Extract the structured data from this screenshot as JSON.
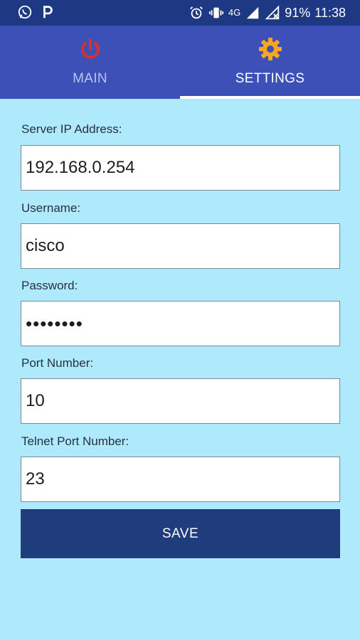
{
  "status_bar": {
    "left_icons": [
      "whatsapp-icon",
      "p-app-icon"
    ],
    "network": "4G",
    "battery": "91%",
    "time": "11:38"
  },
  "tabs": [
    {
      "label": "MAIN",
      "icon": "power-icon",
      "selected": false
    },
    {
      "label": "SETTINGS",
      "icon": "gear-icon",
      "selected": true
    }
  ],
  "form": {
    "server_ip": {
      "label": "Server IP Address:",
      "value": "192.168.0.254"
    },
    "username": {
      "label": "Username:",
      "value": "cisco"
    },
    "password": {
      "label": "Password:",
      "value": "••••••••"
    },
    "port": {
      "label": "Port Number:",
      "value": "10"
    },
    "telnet_port": {
      "label": "Telnet Port Number:",
      "value": "23"
    }
  },
  "save_label": "SAVE",
  "colors": {
    "status_bar": "#1f3883",
    "tab_bar": "#3d50b8",
    "background": "#aeeafb",
    "save_button": "#1f3d7d",
    "power_icon": "#d9312a",
    "gear_icon": "#f5a623"
  }
}
